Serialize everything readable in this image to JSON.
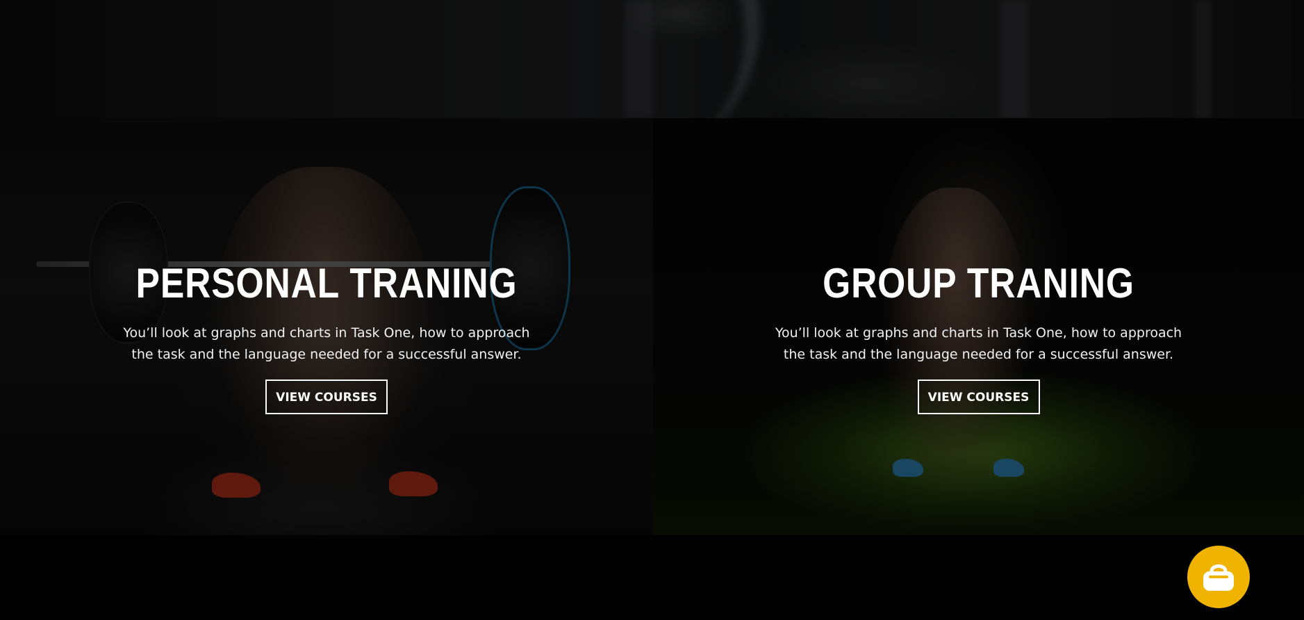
{
  "sections": [
    {
      "id": "personal",
      "title": "PERSONAL TRANING",
      "description": "You’ll look at graphs and charts in Task One, how to approach the task and the language needed for a successful answer.",
      "button_label": "VIEW COURSES"
    },
    {
      "id": "group",
      "title": "GROUP TRANING",
      "description": "You’ll look at graphs and charts in Task One, how to approach the task and the language needed for a successful answer.",
      "button_label": "VIEW COURSES"
    }
  ],
  "cart_button": {
    "icon": "gym-bag-icon",
    "color": "#f0b400"
  },
  "colors": {
    "background": "#000000",
    "accent": "#f0b400",
    "text": "#ffffff"
  }
}
